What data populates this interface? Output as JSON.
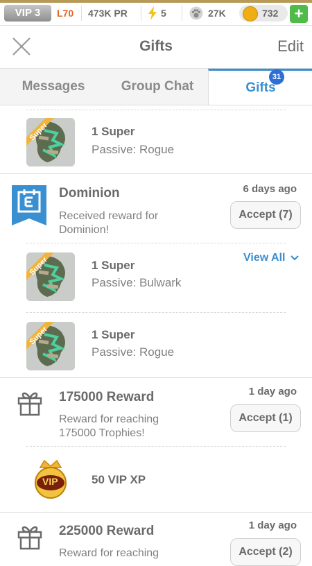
{
  "topbar": {
    "vip": "VIP 3",
    "level": "L70",
    "power": "473K PR",
    "energy": "5",
    "paws": "27K",
    "coins": "732",
    "plus": "+"
  },
  "nav": {
    "title": "Gifts",
    "edit": "Edit"
  },
  "tabs": [
    {
      "label": "Messages"
    },
    {
      "label": "Group Chat"
    },
    {
      "label": "Gifts",
      "badge": "31"
    }
  ],
  "icon_ribbon_text": "Super",
  "rows": {
    "r1": {
      "title": "1 Super",
      "sub": "Passive: Rogue"
    },
    "msg1": {
      "title": "Dominion",
      "time": "6 days ago",
      "body": "Received reward for Dominion!",
      "accept": "Accept (7)",
      "view_all": "View All"
    },
    "r2": {
      "title": "1 Super",
      "sub": "Passive: Bulwark"
    },
    "r3": {
      "title": "1 Super",
      "sub": "Passive: Rogue"
    },
    "msg2": {
      "title": "175000 Reward",
      "time": "1 day ago",
      "body": "Reward for reaching 175000 Trophies!",
      "accept": "Accept (1)"
    },
    "r4": {
      "title": "50 VIP XP",
      "vip_icon_text": "VIP"
    },
    "msg3": {
      "title": "225000 Reward",
      "time": "1 day ago",
      "body": "Reward for reaching",
      "accept": "Accept (2)"
    }
  }
}
